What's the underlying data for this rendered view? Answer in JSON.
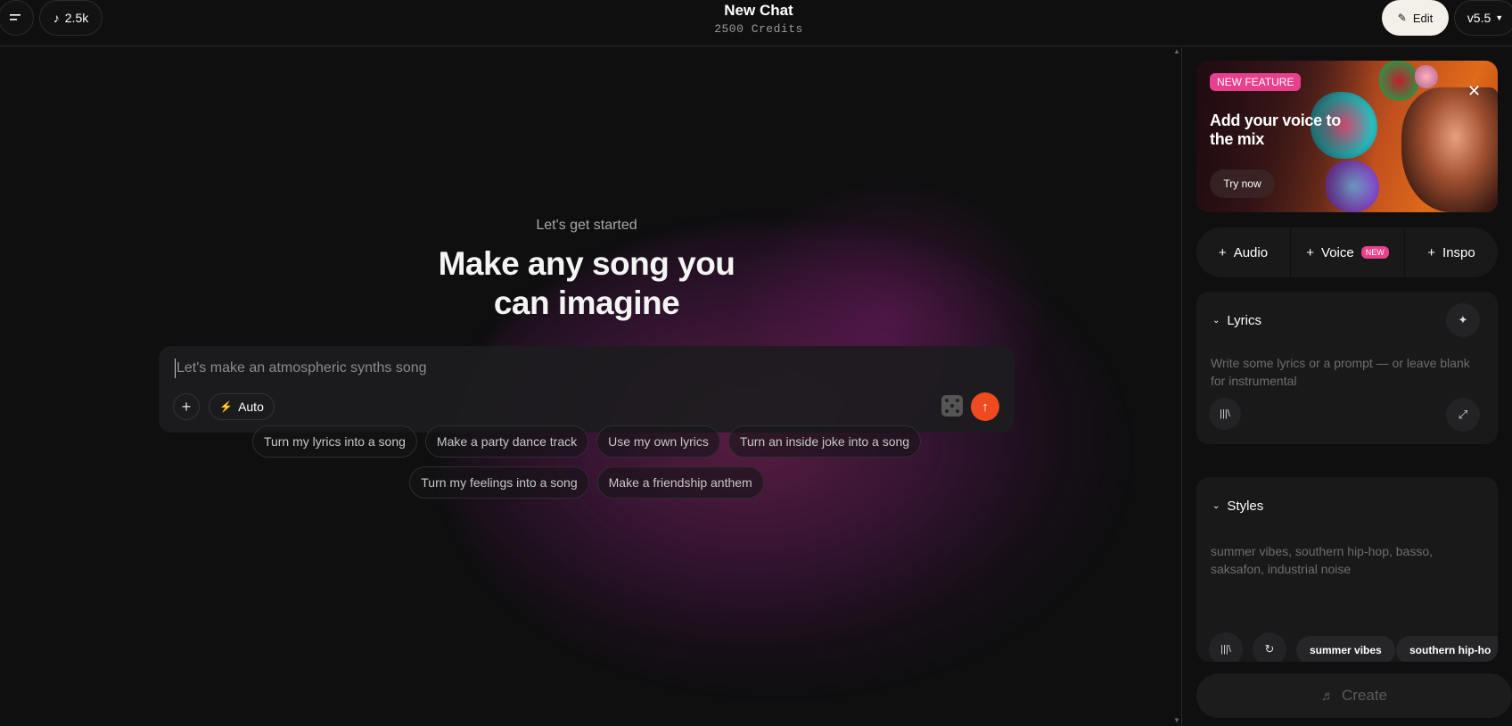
{
  "header": {
    "credits_short": "2.5k",
    "title": "New Chat",
    "credits_label": "2500 Credits",
    "edit_label": "Edit",
    "version_label": "v5.5"
  },
  "hero": {
    "subtitle": "Let's get started",
    "title_line1": "Make any song you",
    "title_line2": "can imagine"
  },
  "prompt": {
    "placeholder": "Let's make an atmospheric synths song",
    "value": "",
    "mode_label": "Auto"
  },
  "suggestions": {
    "row1": [
      "Turn my lyrics into a song",
      "Make a party dance track",
      "Use my own lyrics",
      "Turn an inside joke into a song"
    ],
    "row2": [
      "Turn my feelings into a song",
      "Make a friendship anthem"
    ]
  },
  "promo": {
    "badge": "NEW FEATURE",
    "title": "Add your voice to the mix",
    "cta": "Try now"
  },
  "add_bar": {
    "audio": "Audio",
    "voice": "Voice",
    "voice_badge": "NEW",
    "inspo": "Inspo"
  },
  "lyrics": {
    "heading": "Lyrics",
    "placeholder": "Write some lyrics or a prompt — or leave blank for instrumental"
  },
  "styles": {
    "heading": "Styles",
    "placeholder": "summer vibes, southern hip-hop, basso, saksafon, industrial noise",
    "tags": [
      "summer vibes",
      "southern hip-ho"
    ]
  },
  "create_label": "Create",
  "colors": {
    "accent": "#f04a1f",
    "badge_pink": "#e8408c",
    "background": "#0f0f10"
  }
}
